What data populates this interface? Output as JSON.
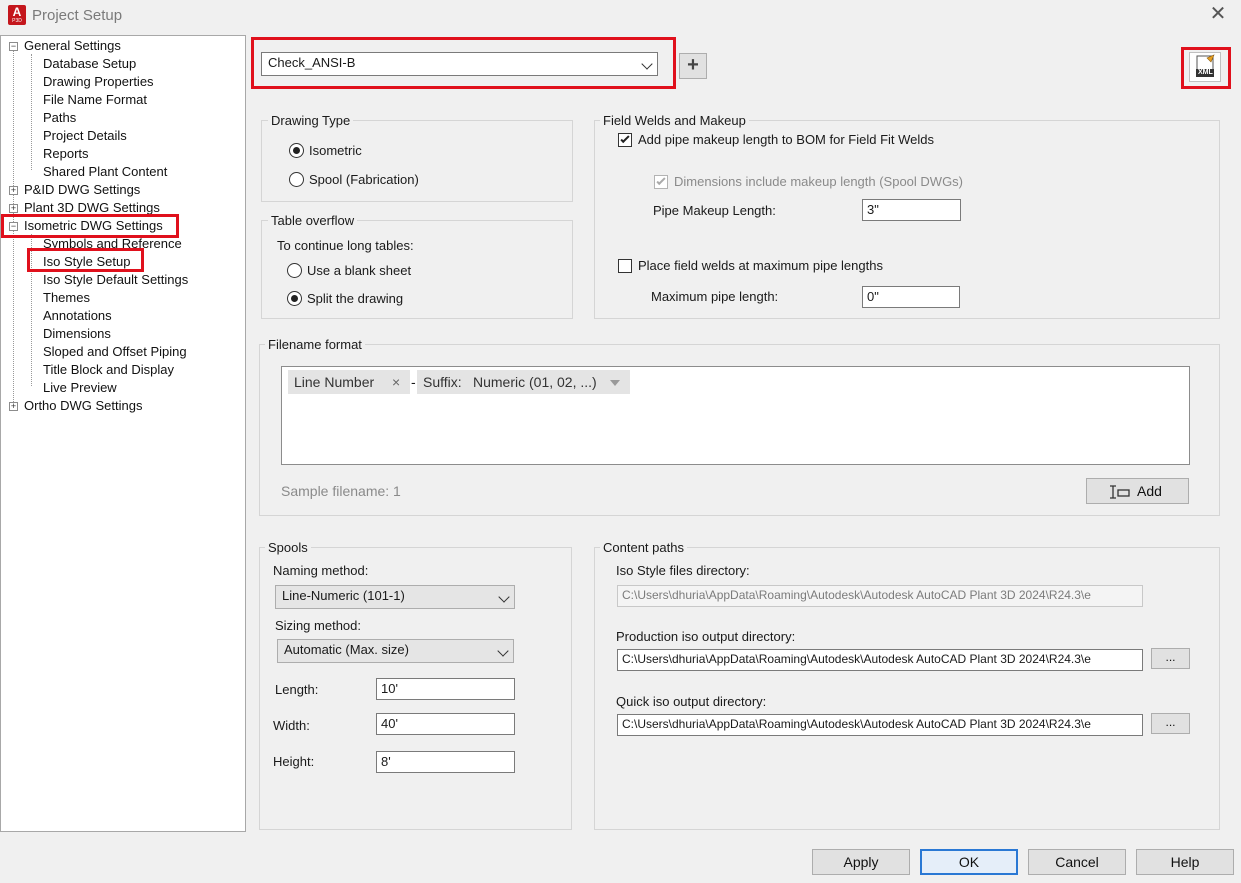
{
  "window": {
    "title": "Project Setup",
    "app_icon_letter": "A",
    "app_icon_sub": "P3D"
  },
  "tree": {
    "items": [
      {
        "label": "General Settings",
        "expander": "−"
      },
      {
        "label": "Database Setup"
      },
      {
        "label": "Drawing Properties"
      },
      {
        "label": "File Name Format"
      },
      {
        "label": "Paths"
      },
      {
        "label": "Project Details"
      },
      {
        "label": "Reports"
      },
      {
        "label": "Shared Plant Content"
      },
      {
        "label": "P&ID DWG Settings",
        "expander": "+"
      },
      {
        "label": "Plant 3D DWG Settings",
        "expander": "+"
      },
      {
        "label": "Isometric DWG Settings",
        "expander": "−"
      },
      {
        "label": "Symbols and Reference"
      },
      {
        "label": "Iso Style Setup"
      },
      {
        "label": "Iso Style Default Settings"
      },
      {
        "label": "Themes"
      },
      {
        "label": "Annotations"
      },
      {
        "label": "Dimensions"
      },
      {
        "label": "Sloped and Offset Piping"
      },
      {
        "label": "Title Block and Display"
      },
      {
        "label": "Live Preview"
      },
      {
        "label": "Ortho DWG Settings",
        "expander": "+"
      }
    ]
  },
  "style_select": {
    "value": "Check_ANSI-B",
    "add_label": "+",
    "xml_label": "XML"
  },
  "drawing_type": {
    "title": "Drawing Type",
    "options": [
      "Isometric",
      "Spool (Fabrication)"
    ],
    "selected": "Isometric"
  },
  "table_overflow": {
    "title": "Table overflow",
    "prompt": "To continue long tables:",
    "options": [
      "Use a blank sheet",
      "Split the drawing"
    ],
    "selected": "Split the drawing"
  },
  "field_welds": {
    "title": "Field Welds and Makeup",
    "add_makeup_label": "Add pipe makeup length to BOM for Field Fit Welds",
    "dims_include_label": "Dimensions include makeup length (Spool DWGs)",
    "makeup_length_label": "Pipe Makeup Length:",
    "makeup_length_value": "3\"",
    "place_welds_label": "Place field welds at maximum pipe lengths",
    "max_length_label": "Maximum pipe length:",
    "max_length_value": "0\""
  },
  "filename_format": {
    "title": "Filename format",
    "token1": "Line Number",
    "token_remove": "×",
    "separator": "-",
    "suffix_label": "Suffix:",
    "suffix_value": "Numeric (01, 02, ...)",
    "sample": "Sample filename: 1",
    "add_label": "Add"
  },
  "spools": {
    "title": "Spools",
    "naming_label": "Naming method:",
    "naming_value": "Line-Numeric (101-1)",
    "sizing_label": "Sizing method:",
    "sizing_value": "Automatic (Max. size)",
    "length_label": "Length:",
    "length_value": "10'",
    "width_label": "Width:",
    "width_value": "40'",
    "height_label": "Height:",
    "height_value": "8'"
  },
  "content_paths": {
    "title": "Content paths",
    "iso_style_label": "Iso Style files directory:",
    "iso_style_value": "C:\\Users\\dhuria\\AppData\\Roaming\\Autodesk\\Autodesk AutoCAD Plant 3D 2024\\R24.3\\e",
    "production_label": "Production iso output directory:",
    "production_value": "C:\\Users\\dhuria\\AppData\\Roaming\\Autodesk\\Autodesk AutoCAD Plant 3D 2024\\R24.3\\e",
    "quick_label": "Quick iso output directory:",
    "quick_value": "C:\\Users\\dhuria\\AppData\\Roaming\\Autodesk\\Autodesk AutoCAD Plant 3D 2024\\R24.3\\e",
    "browse_label": "..."
  },
  "footer": {
    "apply": "Apply",
    "ok": "OK",
    "cancel": "Cancel",
    "help": "Help"
  },
  "colors": {
    "highlight": "#e0101c",
    "primary_border": "#2a78d4",
    "app_icon": "#c4161c"
  }
}
